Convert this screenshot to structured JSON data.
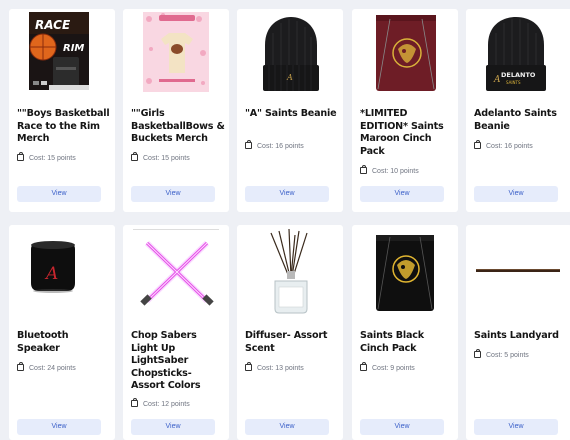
{
  "products": [
    {
      "title": "\"\"Boys Basketball Race to the Rim Merch",
      "cost": "Cost: 15 points",
      "view": "View",
      "image_text": [
        "RACE",
        "RIM"
      ]
    },
    {
      "title": "\"\"Girls BasketballBows & Buckets Merch",
      "cost": "Cost: 15 points",
      "view": "View"
    },
    {
      "title": "\"A\" Saints Beanie",
      "cost": "Cost: 16 points",
      "view": "View"
    },
    {
      "title": "*LIMITED EDITION* Saints Maroon Cinch Pack",
      "cost": "Cost: 10 points",
      "view": "View"
    },
    {
      "title": "Adelanto Saints Beanie",
      "cost": "Cost: 16 points",
      "view": "View",
      "image_text": [
        "DELANTO",
        "SAINTS"
      ]
    },
    {
      "title": "Bluetooth Speaker",
      "cost": "Cost: 24 points",
      "view": "View"
    },
    {
      "title": "Chop Sabers Light Up LightSaber Chopsticks- Assort Colors",
      "cost": "Cost: 12 points",
      "view": "View"
    },
    {
      "title": "Diffuser- Assort Scent",
      "cost": "Cost: 13 points",
      "view": "View"
    },
    {
      "title": "Saints Black Cinch Pack",
      "cost": "Cost: 9 points",
      "view": "View"
    },
    {
      "title": "Saints Landyard",
      "cost": "Cost: 5 points",
      "view": "View"
    }
  ],
  "icons": {
    "cost": "bag-icon"
  }
}
